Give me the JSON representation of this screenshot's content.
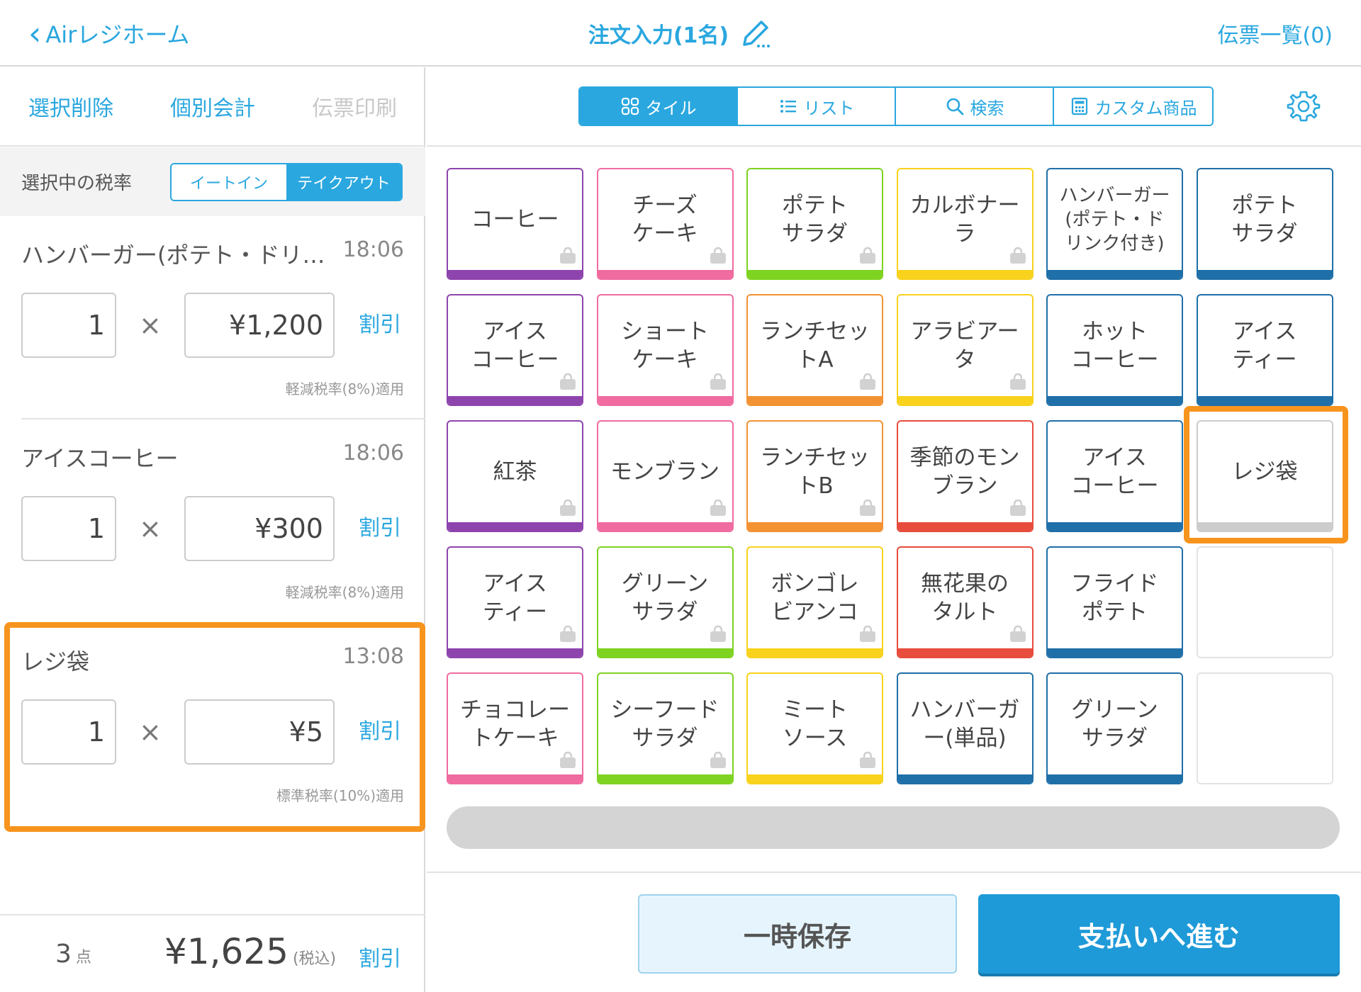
{
  "header": {
    "back_label": "Airレジホーム",
    "title": "注文入力(1名)",
    "slips_label": "伝票一覧(0)"
  },
  "left": {
    "actions": [
      "選択削除",
      "個別会計",
      "伝票印刷"
    ],
    "tax": {
      "label": "選択中の税率",
      "options": [
        "イートイン",
        "テイクアウト"
      ],
      "selected": "テイクアウト"
    },
    "items": [
      {
        "name": "ハンバーガー(ポテト・ドリンク付き)",
        "time": "18:06",
        "qty": "1",
        "times": "×",
        "price": "¥1,200",
        "discount": "割引",
        "rate": "軽減税率(8%)適用"
      },
      {
        "name": "アイスコーヒー",
        "time": "18:06",
        "qty": "1",
        "times": "×",
        "price": "¥300",
        "discount": "割引",
        "rate": "軽減税率(8%)適用"
      },
      {
        "name": "レジ袋",
        "time": "13:08",
        "qty": "1",
        "times": "×",
        "price": "¥5",
        "discount": "割引",
        "rate": "標準税率(10%)適用"
      }
    ],
    "totals": {
      "count": "3",
      "count_unit": "点",
      "sum": "¥1,625",
      "tax_note": "(税込)",
      "discount": "割引"
    }
  },
  "tabs": [
    {
      "label": "タイル",
      "icon": "grid-icon",
      "active": true
    },
    {
      "label": "リスト",
      "icon": "list-icon",
      "active": false
    },
    {
      "label": "検索",
      "icon": "search-icon",
      "active": false
    },
    {
      "label": "カスタム商品",
      "icon": "calculator-icon",
      "active": false
    }
  ],
  "colors": {
    "accent": "#2aa7df",
    "highlight": "#f7941d",
    "purple": "#8e44ad",
    "pink": "#f06ba0",
    "green": "#7ed321",
    "yellow": "#f8d21c",
    "blue": "#1f6fa8",
    "orange": "#f39233",
    "red": "#e74c3c",
    "gray": "#cccccc"
  },
  "tiles": [
    [
      {
        "name": "コーヒー",
        "color": "purple",
        "bag": true
      },
      {
        "name": "チーズ\nケーキ",
        "color": "pink",
        "bag": true
      },
      {
        "name": "ポテト\nサラダ",
        "color": "green",
        "bag": true
      },
      {
        "name": "カルボナー\nラ",
        "color": "yellow",
        "bag": true
      },
      {
        "name": "ハンバーガー\n(ポテト・ド\nリンク付き)",
        "color": "blue",
        "bag": false,
        "small": true
      },
      {
        "name": "ポテト\nサラダ",
        "color": "blue",
        "bag": false
      }
    ],
    [
      {
        "name": "アイス\nコーヒー",
        "color": "purple",
        "bag": true
      },
      {
        "name": "ショート\nケーキ",
        "color": "pink",
        "bag": true
      },
      {
        "name": "ランチセッ\nトA",
        "color": "orange",
        "bag": true
      },
      {
        "name": "アラビアー\nタ",
        "color": "yellow",
        "bag": true
      },
      {
        "name": "ホット\nコーヒー",
        "color": "blue",
        "bag": false
      },
      {
        "name": "アイス\nティー",
        "color": "blue",
        "bag": false
      }
    ],
    [
      {
        "name": "紅茶",
        "color": "purple",
        "bag": true
      },
      {
        "name": "モンブラン",
        "color": "pink",
        "bag": true
      },
      {
        "name": "ランチセッ\nトB",
        "color": "orange",
        "bag": true
      },
      {
        "name": "季節のモン\nブラン",
        "color": "red",
        "bag": true
      },
      {
        "name": "アイス\nコーヒー",
        "color": "blue",
        "bag": false
      },
      {
        "name": "レジ袋",
        "color": "gray",
        "bag": false
      }
    ],
    [
      {
        "name": "アイス\nティー",
        "color": "purple",
        "bag": true
      },
      {
        "name": "グリーン\nサラダ",
        "color": "green",
        "bag": true
      },
      {
        "name": "ボンゴレ\nビアンコ",
        "color": "yellow",
        "bag": true
      },
      {
        "name": "無花果の\nタルト",
        "color": "red",
        "bag": true
      },
      {
        "name": "フライド\nポテト",
        "color": "blue",
        "bag": false
      },
      null
    ],
    [
      {
        "name": "チョコレー\nトケーキ",
        "color": "pink",
        "bag": true
      },
      {
        "name": "シーフード\nサラダ",
        "color": "green",
        "bag": true
      },
      {
        "name": "ミート\nソース",
        "color": "yellow",
        "bag": true
      },
      {
        "name": "ハンバーガ\nー(単品)",
        "color": "blue",
        "bag": false
      },
      {
        "name": "グリーン\nサラダ",
        "color": "blue",
        "bag": false
      },
      null
    ]
  ],
  "buttons": {
    "hold": "一時保存",
    "pay": "支払いへ進む"
  }
}
